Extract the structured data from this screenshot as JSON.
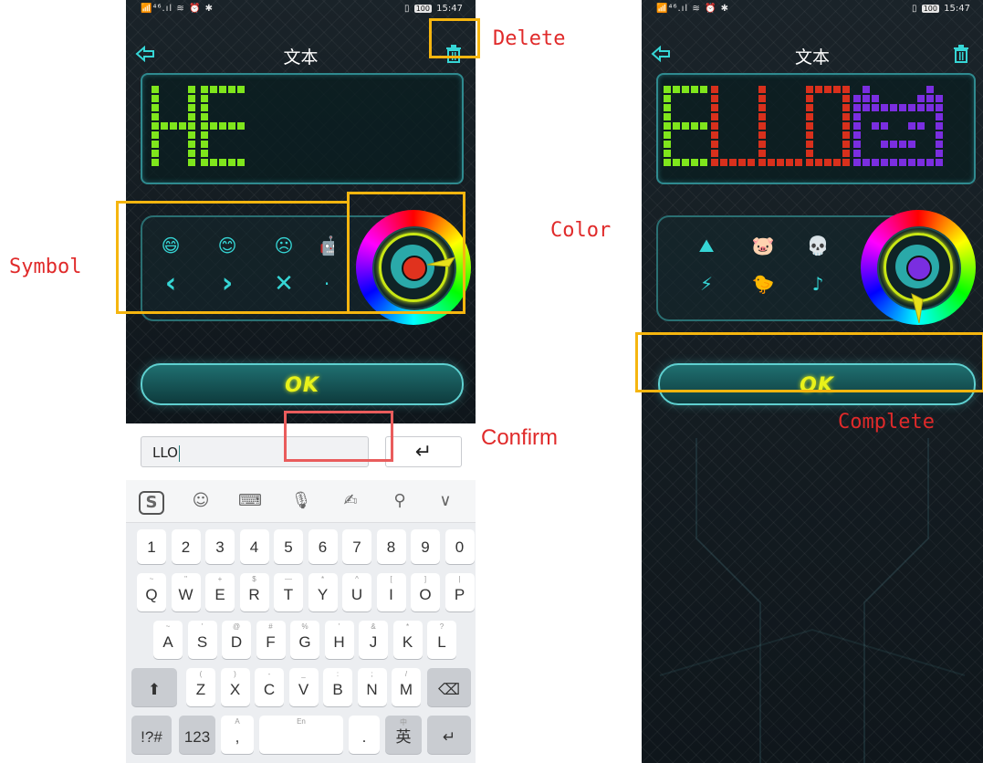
{
  "left_screen": {
    "status": {
      "left": "📶⁴⁶.ıl ≋ ⏰ ✱",
      "battery": "100",
      "time": "15:47"
    },
    "title": "文本",
    "display_text_color": "#7fe61c",
    "symbols_row1": [
      "😄",
      "😊",
      "☹",
      "🤖"
    ],
    "symbols_row2": [
      "‹",
      "›",
      "✕",
      "·"
    ],
    "selected_color": "#e0321e",
    "ok_label": "OK"
  },
  "right_screen": {
    "status": {
      "left": "📶⁴⁶.ıl ≋ ⏰ ✱",
      "battery": "100",
      "time": "15:47"
    },
    "title": "文本",
    "symbols_row1": [
      "⛰",
      "🐷",
      "💀"
    ],
    "symbols_row2": [
      "⚡",
      "🐤",
      "♪"
    ],
    "selected_color": "#7a2ee0",
    "ok_label": "OK"
  },
  "keyboard": {
    "input_value": "LLO",
    "enter_symbol": "↵",
    "toolbar": [
      "S",
      "☺",
      "⌨",
      "🎙",
      "✍",
      "⚲",
      "∨"
    ],
    "row_numbers": [
      "1",
      "2",
      "3",
      "4",
      "5",
      "6",
      "7",
      "8",
      "9",
      "0"
    ],
    "row_q": [
      [
        "~",
        "Q"
      ],
      [
        "\"",
        "W"
      ],
      [
        "+",
        "E"
      ],
      [
        "$",
        "R"
      ],
      [
        "—",
        "T"
      ],
      [
        "*",
        "Y"
      ],
      [
        "^",
        "U"
      ],
      [
        "[",
        "I"
      ],
      [
        "]",
        "O"
      ],
      [
        "|",
        "P"
      ]
    ],
    "row_a": [
      [
        "~",
        "A"
      ],
      [
        "'",
        "S"
      ],
      [
        "@",
        "D"
      ],
      [
        "#",
        "F"
      ],
      [
        "%",
        "G"
      ],
      [
        "'",
        "H"
      ],
      [
        "&",
        "J"
      ],
      [
        "*",
        "K"
      ],
      [
        "?",
        "L"
      ]
    ],
    "row_z": [
      [
        "(",
        "Z"
      ],
      [
        ")",
        "X"
      ],
      [
        "-",
        "C"
      ],
      [
        "_",
        "V"
      ],
      [
        ":",
        "B"
      ],
      [
        ";",
        "N"
      ],
      [
        "/",
        "M"
      ]
    ],
    "shift_symbol": "⬆",
    "backspace_symbol": "⌫",
    "symbols_key": "!?#",
    "num_key": "123",
    "comma_key": ",",
    "comma_sub": "A",
    "space_sub": "En",
    "period_key": ".",
    "lang_key": "英",
    "lang_sub": "中",
    "return_symbol": "↵"
  },
  "annotations": {
    "delete": "Delete",
    "symbol": "Symbol",
    "color": "Color",
    "confirm": "Confirm",
    "complete": "Complete"
  },
  "colors": {
    "box": "#f5b50f",
    "label": "#e02a2a",
    "confirm_box": "#e95c5c",
    "green": "#7fe61c",
    "red": "#d8301c",
    "purple": "#7a2ee0"
  }
}
